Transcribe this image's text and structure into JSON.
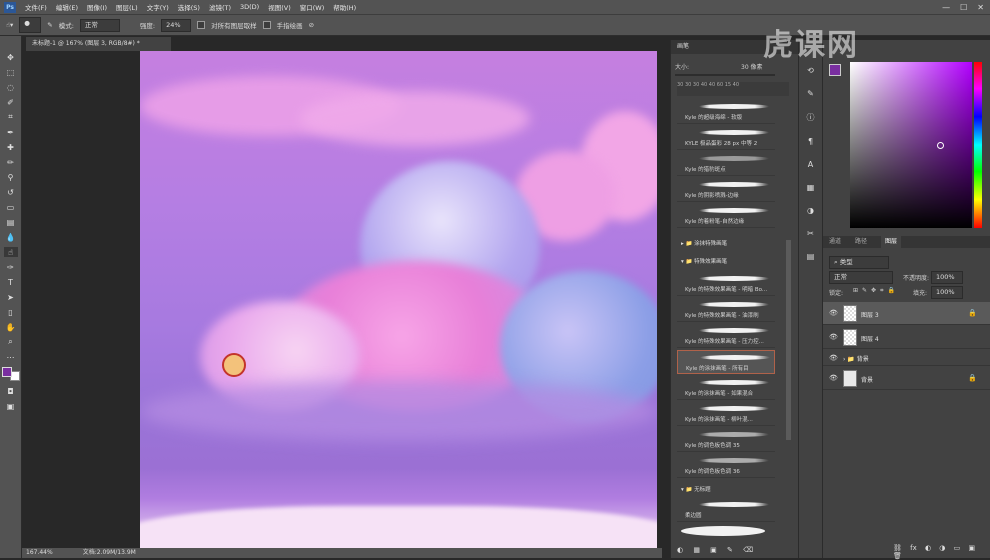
{
  "menu": {
    "items": [
      "文件(F)",
      "编辑(E)",
      "图像(I)",
      "图层(L)",
      "文字(Y)",
      "选择(S)",
      "滤镜(T)",
      "3D(D)",
      "视图(V)",
      "窗口(W)",
      "帮助(H)"
    ]
  },
  "options": {
    "mode_label": "模式:",
    "mode_value": "正常",
    "opacity_label": "强度:",
    "opacity_value": "24%",
    "sample_all_label": "对所有图层取样",
    "finger_paint_label": "手指绘画"
  },
  "document": {
    "tab_title": "未标题-1 @ 167% (图层 3, RGB/8#) *"
  },
  "status": {
    "zoom": "167.44%",
    "doc_info": "文档:2.09M/13.9M"
  },
  "brush_panel": {
    "title": "画笔",
    "size_label": "大小:",
    "size_value": "30 像素",
    "presets": [
      "Kyle 的超级海绵 - 软版",
      "KYLE 极品蛋彩 28 px 中等 2",
      "Kyle 的猎豹斑点",
      "Kyle 的阴影喷溅-边缘",
      "Kyle 的着粉笔-自然边缘"
    ],
    "groups": [
      "涂抹特殊画笔",
      "特殊效果画笔",
      "无标题"
    ],
    "special": [
      "Kyle 的特殊效果画笔 - 明暗 Bo...",
      "Kyle 的特殊效果画笔 - 油漆刷",
      "Kyle 的特殊效果画笔 - 压力控...",
      "Kyle 的涂抹画笔 - 所有目",
      "Kyle 的涂抹画笔 - 如果混合",
      "Kyle 的涂抹画笔 - 柳叶混...",
      "Kyle 的调色板色调 35",
      "Kyle 的调色板色调 36"
    ],
    "last_label": "柔边圆"
  },
  "layers_panel": {
    "tabs": [
      "图层",
      "通道",
      "路径"
    ],
    "kind_label": "类型",
    "blend_mode": "正常",
    "opacity_label": "不透明度:",
    "opacity_value": "100%",
    "lock_label": "锁定:",
    "fill_label": "填充:",
    "fill_value": "100%",
    "layers": [
      "图层 3",
      "图层 4",
      "背景",
      "背景"
    ]
  },
  "watermark": {
    "text": "虎课网"
  },
  "colors": {
    "foreground": "#7a2fa0",
    "background": "#ffffff",
    "accent_selection": "#b0624a"
  }
}
